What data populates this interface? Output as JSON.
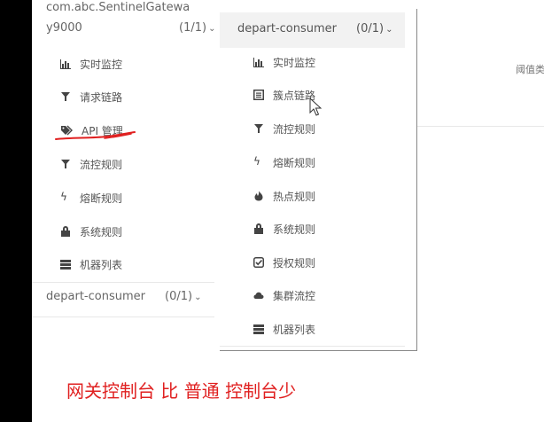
{
  "left_panel": {
    "app_name": "com.abc.SentinelGatewa",
    "app_name_cont": "y9000",
    "app_count": "(1/1)",
    "items": [
      {
        "label": "实时监控",
        "icon": "bar-chart-icon"
      },
      {
        "label": "请求链路",
        "icon": "funnel-icon"
      },
      {
        "label": "API 管理",
        "icon": "tags-icon"
      },
      {
        "label": "流控规则",
        "icon": "funnel-icon"
      },
      {
        "label": "熔断规则",
        "icon": "bolt-icon"
      },
      {
        "label": "系统规则",
        "icon": "lock-icon"
      },
      {
        "label": "机器列表",
        "icon": "list-icon"
      }
    ],
    "second_app_name": "depart-consumer",
    "second_app_count": "(0/1)"
  },
  "right_panel": {
    "app_name": "depart-consumer",
    "app_count": "(0/1)",
    "items": [
      {
        "label": "实时监控",
        "icon": "bar-chart-icon"
      },
      {
        "label": "簇点链路",
        "icon": "list-alt-icon"
      },
      {
        "label": "流控规则",
        "icon": "funnel-icon"
      },
      {
        "label": "熔断规则",
        "icon": "bolt-icon"
      },
      {
        "label": "热点规则",
        "icon": "fire-icon"
      },
      {
        "label": "系统规则",
        "icon": "lock-icon"
      },
      {
        "label": "授权规则",
        "icon": "check-square-icon"
      },
      {
        "label": "集群流控",
        "icon": "cloud-icon"
      },
      {
        "label": "机器列表",
        "icon": "list-icon"
      }
    ]
  },
  "threshold_label": "阈值类",
  "caption": "网关控制台 比 普通 控制台少",
  "colors": {
    "annotation": "#e02020",
    "header_bg": "#f2f2f2",
    "text": "#555555"
  }
}
